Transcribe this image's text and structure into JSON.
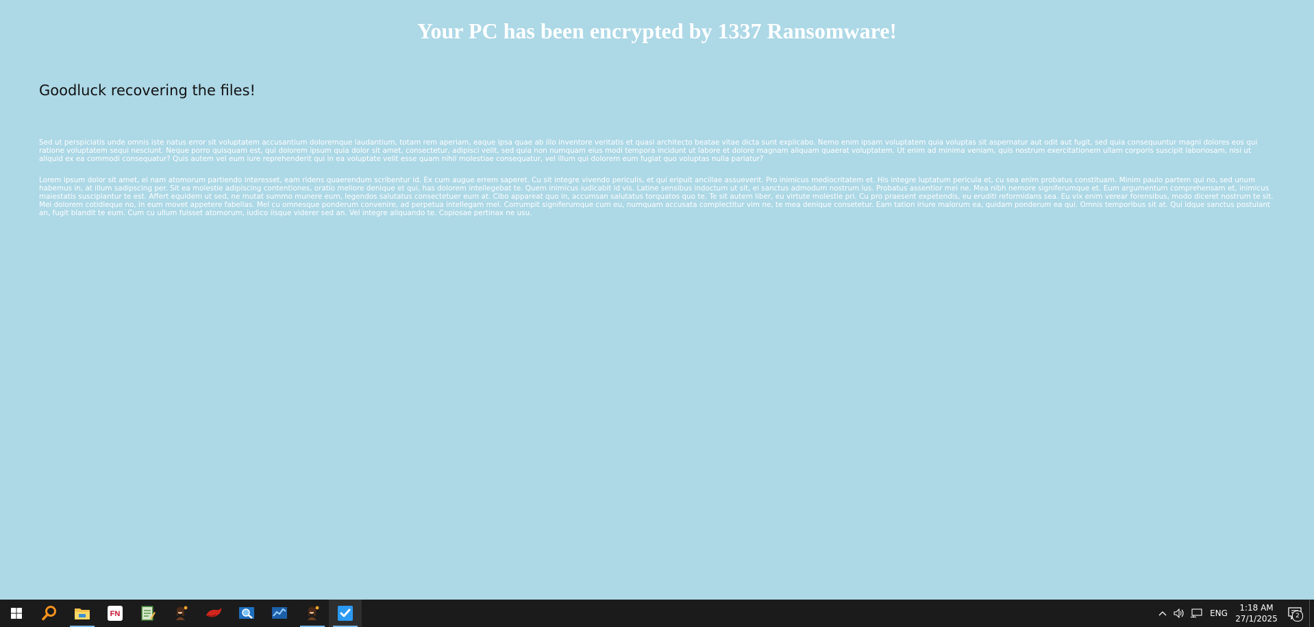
{
  "main": {
    "title": "Your PC has been encrypted by 1337 Ransomware!",
    "subtitle": "Goodluck recovering the files!",
    "paragraph1": "Sed ut perspiciatis unde omnis iste natus error sit voluptatem accusantium doloremque laudantium, totam rem aperiam, eaque ipsa quae ab illo inventore veritatis et quasi architecto beatae vitae dicta sunt explicabo. Nemo enim ipsam voluptatem quia voluptas sit aspernatur aut odit aut fugit, sed quia consequuntur magni dolores eos qui ratione voluptatem sequi nesciunt. Neque porro quisquam est, qui dolorem ipsum quia dolor sit amet, consectetur, adipisci velit, sed quia non numquam eius modi tempora incidunt ut labore et dolore magnam aliquam quaerat voluptatem. Ut enim ad minima veniam, quis nostrum exercitationem ullam corporis suscipit laboriosam, nisi ut aliquid ex ea commodi consequatur? Quis autem vel eum iure reprehenderit qui in ea voluptate velit esse quam nihil molestiae consequatur, vel illum qui dolorem eum fugiat quo voluptas nulla pariatur?",
    "paragraph2": "Lorem ipsum dolor sit amet, ei nam atomorum partiendo interesset, eam ridens quaerendum scribentur id. Ex cum augue errem saperet. Cu sit integre vivendo periculis, et qui eripuit ancillae assueverit. Pro inimicus mediocritatem et. His integre luptatum pericula et, cu sea enim probatus constituam. Minim paulo partem qui no, sed unum habemus in, at illum sadipscing per. Sit ea molestie adipiscing contentiones, oratio meliore denique et qui, has dolorem intellegebat te. Quem inimicus iudicabit id vis. Latine sensibus indoctum ut sit, ei sanctus admodum nostrum ius. Probatus assentior mei ne. Mea nibh nemore signiferumque et. Eum argumentum comprehensam et, inimicus maiestatis suscipiantur te est. Affert equidem ut sed, ne mutat summo munere eum, legendos salutatus consectetuer eum at. Cibo appareat quo in, accumsan salutatus torquatos quo te. Te sit autem liber, eu virtute molestie pri. Cu pro praesent expetendis, eu eruditi reformidans sea. Eu vix enim verear forensibus, modo diceret nostrum te sit. Mei dolorem cotidieque no, in eum movet appetere fabellas. Mel cu omnesque ponderum convenire, ad perpetua intellegam mel. Corrumpit signiferumque cum eu, numquam accusata complectitur vim ne, te mea denique consetetur. Eam tation iriure malorum ea, quidam ponderum ea qui. Omnis temporibus sit at. Qui idque sanctus postulant an, fugit blandit te eum. Cum cu ullum fuisset atomorum, iudico iisque viderer sed an. Vel integre aliquando te. Copiosae pertinax ne usu.",
    "colors": {
      "background": "#add8e6",
      "title": "#ffffff",
      "subtitle": "#111111",
      "body_text": "#ffffff"
    }
  },
  "taskbar": {
    "apps": [
      {
        "icon": "windows-start-icon"
      },
      {
        "icon": "search-magnifier-icon"
      },
      {
        "icon": "file-explorer-icon"
      },
      {
        "icon": "fn-app-icon",
        "label": "FN"
      },
      {
        "icon": "notepad-app-icon"
      },
      {
        "icon": "character-app-icon"
      },
      {
        "icon": "red-app-icon"
      },
      {
        "icon": "blue-search-app-icon"
      },
      {
        "icon": "chart-app-icon"
      },
      {
        "icon": "character-app-icon-2"
      },
      {
        "icon": "checkmark-app-icon"
      }
    ],
    "tray": {
      "language": "ENG",
      "time": "1:18 AM",
      "date": "27/1/2025",
      "notification_count": "2"
    },
    "colors": {
      "background": "#1b1b1b",
      "active_indicator": "#76b9ed"
    }
  }
}
